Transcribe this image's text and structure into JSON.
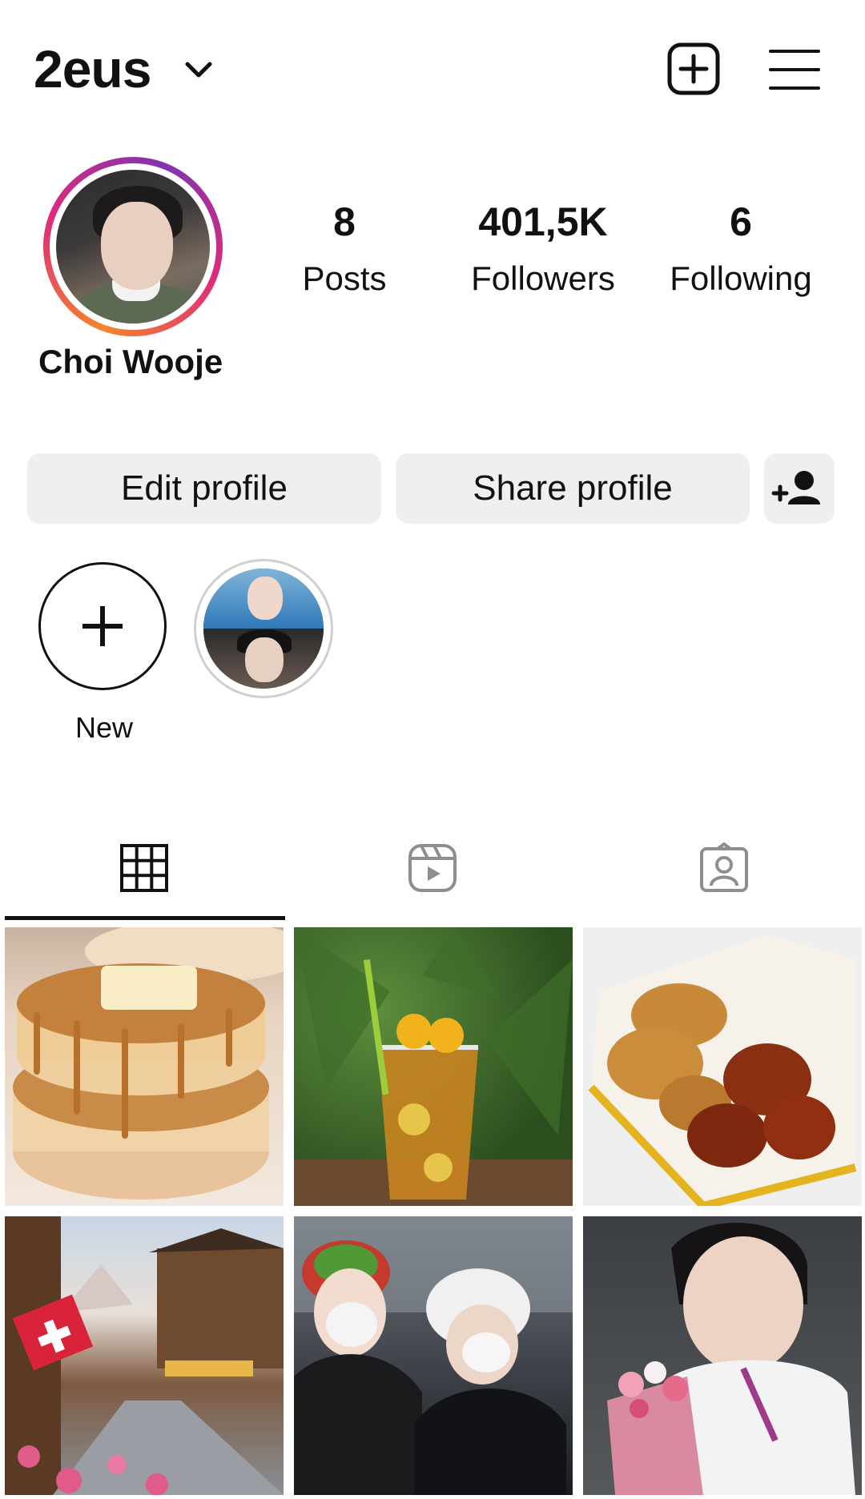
{
  "header": {
    "username": "2eus",
    "icons": {
      "chevron": "chevron-down-icon",
      "add": "add-post-icon",
      "menu": "hamburger-menu-icon"
    }
  },
  "profile": {
    "display_name": "Choi Wooje",
    "stats": [
      {
        "value": "8",
        "label": "Posts"
      },
      {
        "value": "401,5K",
        "label": "Followers"
      },
      {
        "value": "6",
        "label": "Following"
      }
    ]
  },
  "actions": {
    "edit_label": "Edit profile",
    "share_label": "Share profile"
  },
  "highlights": {
    "new_label": "New"
  },
  "tabs": [
    "grid",
    "reels",
    "tagged"
  ],
  "posts_count_shown": 6,
  "colors": {
    "button_bg": "#efefef",
    "story_ring": "#dd2a7b",
    "text": "#111111"
  }
}
